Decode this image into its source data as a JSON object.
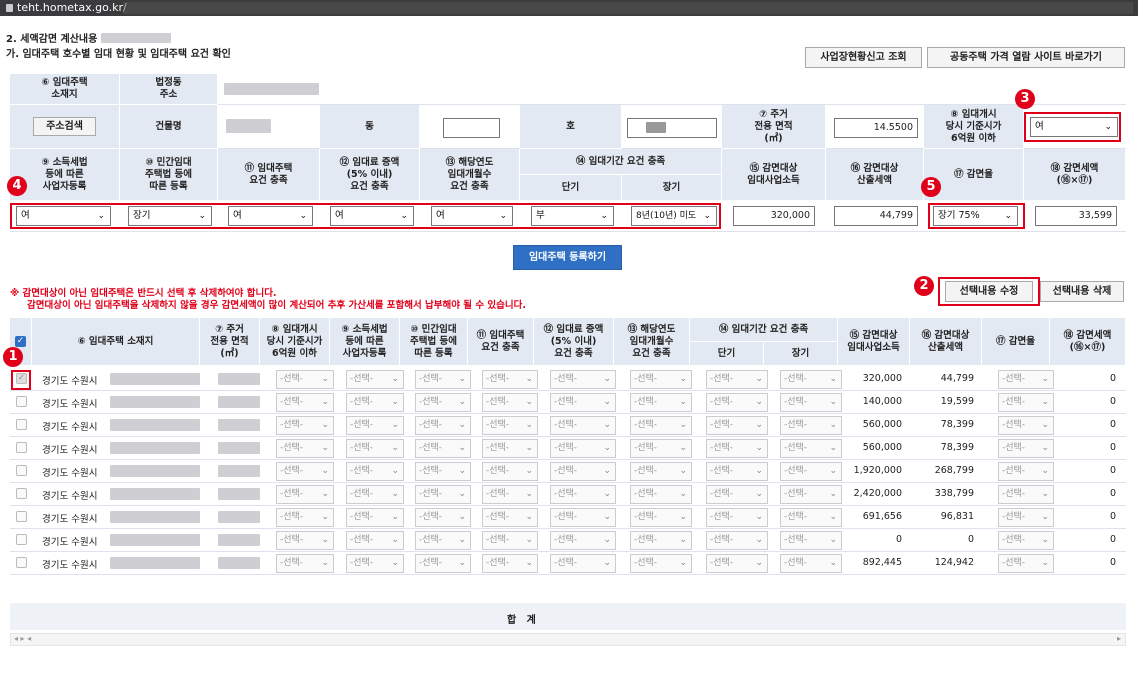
{
  "browser": {
    "url": "teht.hometax.go.kr/"
  },
  "section": {
    "title": "2. 세액감면 계산내용",
    "subtitle": "가. 임대주택 호수별 임대 현황 및 임대주택 요건 확인"
  },
  "buttons": {
    "business_report": "사업장현황신고 조회",
    "price_site": "공동주택 가격 열람 사이트 바로가기",
    "address_search": "주소검색",
    "register": "임대주택 등록하기",
    "edit_selected": "선택내용 수정",
    "delete_selected": "선택내용 삭제"
  },
  "top_form": {
    "h_location": "⑥ 임대주택\n소재지",
    "h_legal_address": "법정동\n주소",
    "h_building": "건물명",
    "h_dong": "동",
    "h_ho": "호",
    "h_area": "⑦ 주거\n전용 면적\n(㎡)",
    "area_value": "14.5500",
    "h_price": "⑧ 임대개시\n당시 기준시가\n6억원 이하",
    "price_value": "여",
    "h9": "⑨ 소득세법\n등에 따른\n사업자등록",
    "h10": "⑩ 민간임대\n주택법 등에\n따른 등록",
    "h11": "⑪ 임대주택\n요건 충족",
    "h12": "⑫ 임대료 증액\n(5% 이내)\n요건 충족",
    "h13": "⑬ 해당연도\n임대개월수\n요건 충족",
    "h14": "⑭ 임대기간 요건 충족",
    "h14_short": "단기",
    "h14_long": "장기",
    "h15": "⑮ 감면대상\n임대사업소득",
    "h16": "⑯ 감면대상\n산출세액",
    "h17": "⑰ 감면율",
    "h18": "⑱ 감면세액\n(⑯×⑰)",
    "v9": "여",
    "v10": "장기",
    "v11": "여",
    "v12": "여",
    "v13": "여",
    "v14_short": "부",
    "v14_long": "8년(10년) 미도",
    "v15": "320,000",
    "v16": "44,799",
    "v17": "장기 75%",
    "v18": "33,599"
  },
  "notes": {
    "line1": "※ 감면대상이 아닌 임대주택은 반드시 선택 후 삭제하여야 합니다.",
    "line2": "감면대상이 아닌 임대주택을 삭제하지 않을 경우 감면세액이 많이 계산되어 추후 가산세를 포함해서 납부해야 될 수 있습니다."
  },
  "list": {
    "headers": {
      "location": "⑥ 임대주택 소재지",
      "area": "⑦ 주거\n전용 면적\n(㎡)",
      "price": "⑧ 임대개시\n당시 기준시가\n6억원 이하",
      "h9": "⑨ 소득세법\n등에 따른\n사업자등록",
      "h10": "⑩ 민간임대\n주택법 등에\n따른 등록",
      "h11": "⑪ 임대주택\n요건 충족",
      "h12": "⑫ 임대료 증액\n(5% 이내)\n요건 충족",
      "h13": "⑬ 해당연도\n임대개월수\n요건 충족",
      "h14": "⑭ 임대기간 요건 충족",
      "short": "단기",
      "long": "장기",
      "h15": "⑮ 감면대상\n임대사업소득",
      "h16": "⑯ 감면대상\n산출세액",
      "h17": "⑰ 감면율",
      "h18": "⑱ 감면세액\n(⑯×⑰)"
    },
    "select_placeholder": "-선택-",
    "rows": [
      {
        "addr": "경기도 수원시",
        "income": "320,000",
        "tax": "44,799",
        "reduction": "0"
      },
      {
        "addr": "경기도 수원시",
        "income": "140,000",
        "tax": "19,599",
        "reduction": "0"
      },
      {
        "addr": "경기도 수원시",
        "income": "560,000",
        "tax": "78,399",
        "reduction": "0"
      },
      {
        "addr": "경기도 수원시",
        "income": "560,000",
        "tax": "78,399",
        "reduction": "0"
      },
      {
        "addr": "경기도 수원시",
        "income": "1,920,000",
        "tax": "268,799",
        "reduction": "0"
      },
      {
        "addr": "경기도 수원시",
        "income": "2,420,000",
        "tax": "338,799",
        "reduction": "0"
      },
      {
        "addr": "경기도 수원시",
        "income": "691,656",
        "tax": "96,831",
        "reduction": "0"
      },
      {
        "addr": "경기도 수원시",
        "income": "0",
        "tax": "0",
        "reduction": "0"
      },
      {
        "addr": "경기도 수원시",
        "income": "892,445",
        "tax": "124,942",
        "reduction": "0"
      }
    ],
    "total_label": "합   계"
  },
  "badges": [
    "1",
    "2",
    "3",
    "4",
    "5"
  ],
  "colors": {
    "header_bg": "#e3e9f3",
    "highlight": "#e0001a",
    "primary_btn": "#2f6fc4"
  }
}
